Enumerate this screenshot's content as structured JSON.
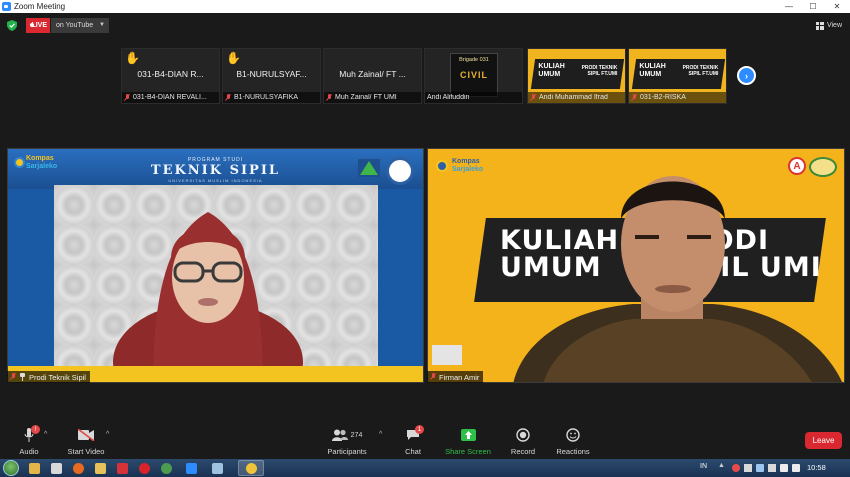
{
  "window": {
    "title": "Zoom Meeting",
    "minimize": "—",
    "maximize": "☐",
    "close": "✕"
  },
  "top": {
    "live_label": "LIVE",
    "stream_label": "on YouTube",
    "view_label": "View"
  },
  "thumbnails": [
    {
      "big_name": "031-B4-DIAN R...",
      "caption": "031-B4-DIAN REVALI...",
      "raised_hand": true
    },
    {
      "big_name": "B1-NURULSYAF...",
      "caption": "B1-NURULSYAFIKA",
      "raised_hand": true
    },
    {
      "big_name": "Muh Zainal/ FT ...",
      "caption": "Muh Zainal/ FT UMI",
      "raised_hand": false
    },
    {
      "caption": "Andi Alifuddin",
      "logo_top": "Brigade 031",
      "logo_main": "CIVIL"
    },
    {
      "caption": "Andi Muhammad Ifrad",
      "banner_left": "KULIAH UMUM",
      "banner_right": "PRODI TEKNIK SIPIL FT.UMI"
    },
    {
      "caption": "031-B2-RISKA",
      "banner_left": "KULIAH UMUM",
      "banner_right": "PRODI TEKNIK SIPIL FT.UMI"
    }
  ],
  "main_left": {
    "name": "Prodi Teknik Sipil",
    "logo_line1": "Kompas",
    "logo_line2": "Sarjaleko",
    "header_small": "PROGRAM STUDI",
    "header_big": "TEKNIK SIPIL",
    "header_sub": "UNIVERSITAS MUSLIM INDONESIA"
  },
  "main_right": {
    "name": "Firman Amir",
    "logo_line1": "Kompas",
    "logo_line2": "Sarjaleko",
    "banner_left": "KULIAH\nUMUM",
    "banner_right": "PRODI\nSIPIL UMI",
    "logo_a": "A"
  },
  "toolbar": {
    "audio": "Audio",
    "video": "Start Video",
    "participants": "Participants",
    "participants_count": "274",
    "chat": "Chat",
    "chat_badge": "1",
    "audio_badge": "!",
    "share": "Share Screen",
    "record": "Record",
    "reactions": "Reactions",
    "leave": "Leave"
  },
  "taskbar": {
    "lang": "IN",
    "time": "10:58"
  },
  "colors": {
    "live_red": "#d9282f",
    "zoom_blue": "#2d8cff",
    "share_green": "#2fbe4a",
    "banner_yellow": "#f4b21b"
  }
}
